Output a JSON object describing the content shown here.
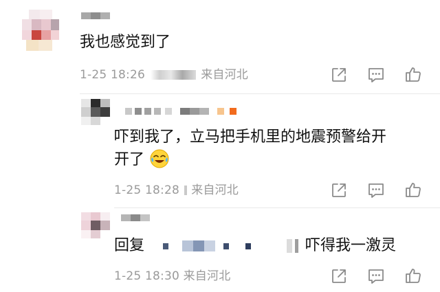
{
  "comments": [
    {
      "text": "我也感觉到了",
      "time": "1-25 18:26",
      "location": "来自河北",
      "actions": {
        "share": "share-icon",
        "reply": "comment-icon",
        "like": "thumbs-up-icon"
      }
    },
    {
      "text_line1": "吓到我了，立马把手机里的地震预警给开",
      "text_line2": "开了",
      "emoji": "laughing-crying-emoji",
      "time": "1-25 18:28",
      "location": "来自河北",
      "actions": {
        "share": "share-icon",
        "reply": "comment-icon",
        "like": "thumbs-up-icon"
      }
    },
    {
      "reply_prefix": "回复",
      "text": "吓得我一激灵",
      "time": "1-25 18:30",
      "location": "来自河北",
      "actions": {
        "share": "share-icon",
        "reply": "comment-icon",
        "like": "thumbs-up-icon"
      }
    }
  ],
  "colors": {
    "text": "#111111",
    "meta": "#9a9a9a",
    "icon": "#8a8a8a",
    "badge_orange": "#f5a05a"
  }
}
